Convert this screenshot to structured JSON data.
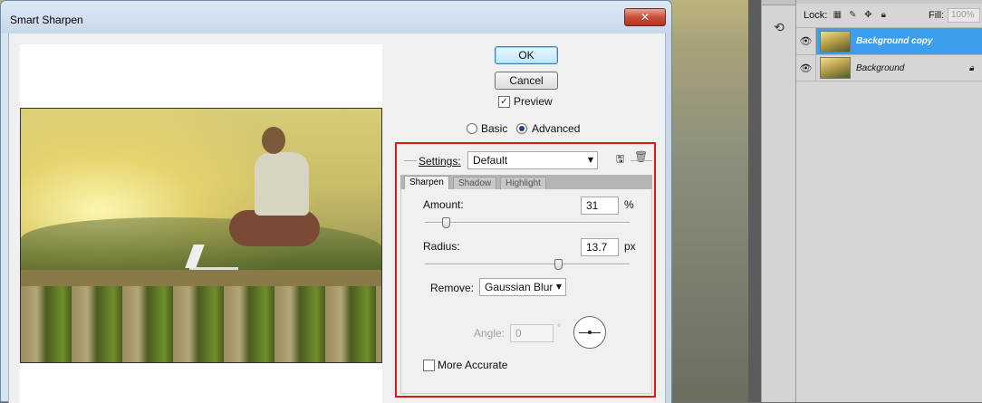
{
  "dialog": {
    "title": "Smart Sharpen",
    "close_glyph": "✕",
    "ok_label": "OK",
    "cancel_label": "Cancel",
    "preview_label": "Preview",
    "preview_checked": true,
    "mode_basic_label": "Basic",
    "mode_advanced_label": "Advanced",
    "mode_selected": "Advanced"
  },
  "settings": {
    "label": "Settings:",
    "value": "Default",
    "save_icon": "save-settings-icon",
    "delete_icon": "trash-icon"
  },
  "tabs": [
    {
      "label": "Sharpen",
      "active": true
    },
    {
      "label": "Shadow",
      "active": false
    },
    {
      "label": "Highlight",
      "active": false
    }
  ],
  "sharpen": {
    "amount_label": "Amount:",
    "amount_value": "31",
    "amount_unit": "%",
    "amount_slider_fraction": 0.1,
    "radius_label": "Radius:",
    "radius_value": "13.7",
    "radius_unit": "px",
    "radius_slider_fraction": 0.65,
    "remove_label": "Remove:",
    "remove_value": "Gaussian Blur",
    "angle_label": "Angle:",
    "angle_value": "0",
    "angle_unit": "°",
    "more_accurate_label": "More Accurate",
    "more_accurate_checked": false
  },
  "layers_panel": {
    "lock_label": "Lock:",
    "fill_label": "Fill:",
    "fill_value": "100%",
    "layers": [
      {
        "name": "Background copy",
        "selected": true,
        "locked": false
      },
      {
        "name": "Background",
        "selected": false,
        "locked": true
      }
    ]
  },
  "colors": {
    "highlight_box": "#e01818",
    "selected_layer": "#3d9ef0"
  }
}
